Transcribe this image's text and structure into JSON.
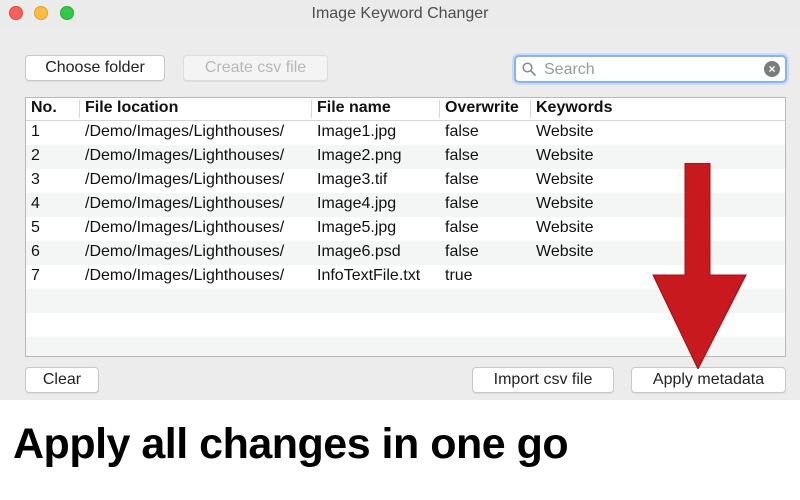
{
  "window": {
    "title": "Image Keyword Changer"
  },
  "toolbar": {
    "choose_folder_label": "Choose folder",
    "create_csv_label": "Create csv file",
    "search_placeholder": "Search",
    "search_value": ""
  },
  "table": {
    "columns": [
      "No.",
      "File location",
      "File name",
      "Overwrite",
      "Keywords"
    ],
    "rows": [
      [
        "1",
        "/Demo/Images/Lighthouses/",
        "Image1.jpg",
        "false",
        "Website"
      ],
      [
        "2",
        "/Demo/Images/Lighthouses/",
        "Image2.png",
        "false",
        "Website"
      ],
      [
        "3",
        "/Demo/Images/Lighthouses/",
        "Image3.tif",
        "false",
        "Website"
      ],
      [
        "4",
        "/Demo/Images/Lighthouses/",
        "Image4.jpg",
        "false",
        "Website"
      ],
      [
        "5",
        "/Demo/Images/Lighthouses/",
        "Image5.jpg",
        "false",
        "Website"
      ],
      [
        "6",
        "/Demo/Images/Lighthouses/",
        "Image6.psd",
        "false",
        "Website"
      ],
      [
        "7",
        "/Demo/Images/Lighthouses/",
        "InfoTextFile.txt",
        "true",
        ""
      ]
    ]
  },
  "footer": {
    "clear_label": "Clear",
    "import_csv_label": "Import csv file",
    "apply_metadata_label": "Apply metadata"
  },
  "caption": {
    "headline": "Apply all changes in one go"
  },
  "colors": {
    "arrow": "#c8191e",
    "focus_ring": "#8ab4f0"
  }
}
